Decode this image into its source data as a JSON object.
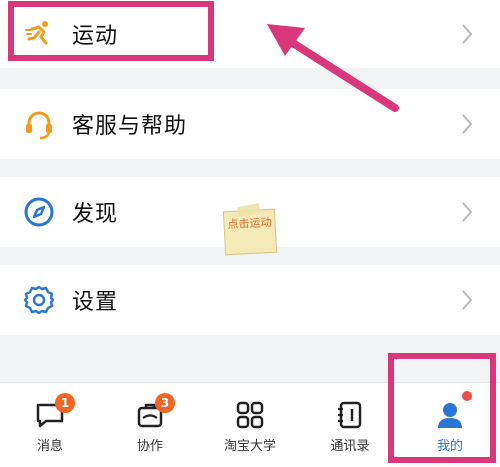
{
  "menu": {
    "items": [
      {
        "label": "运动",
        "icon": "running-icon"
      },
      {
        "label": "客服与帮助",
        "icon": "headset-icon"
      },
      {
        "label": "发现",
        "icon": "compass-icon"
      },
      {
        "label": "设置",
        "icon": "gear-icon"
      }
    ]
  },
  "annotation": {
    "note_text": "点击运动"
  },
  "tabbar": {
    "tabs": [
      {
        "label": "消息",
        "badge": "1"
      },
      {
        "label": "协作",
        "badge": "3"
      },
      {
        "label": "淘宝大学",
        "badge": ""
      },
      {
        "label": "通讯录",
        "badge": ""
      },
      {
        "label": "我的",
        "badge": ""
      }
    ]
  },
  "colors": {
    "accent": "#2a76d6",
    "sport_icon": "#f39a1e",
    "highlight": "#d8377c",
    "badge": "#f26522"
  }
}
